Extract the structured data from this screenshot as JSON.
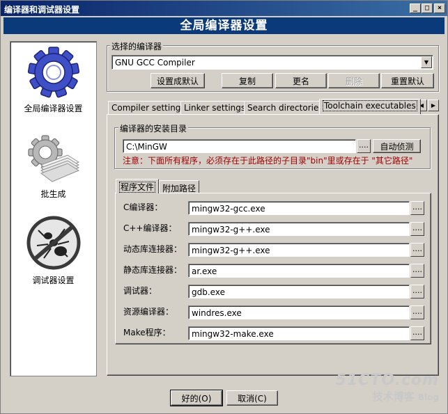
{
  "window": {
    "title": "编译器和调试器设置",
    "controls": [
      "_",
      "□",
      "×"
    ]
  },
  "banner": {
    "title": "全局编译器设置"
  },
  "sidebar": {
    "items": [
      {
        "label": "全局编译器设置",
        "icon": "gear-icon"
      },
      {
        "label": "批生成",
        "icon": "batch-build-icon"
      },
      {
        "label": "调试器设置",
        "icon": "debugger-ant-icon"
      }
    ]
  },
  "compiler_select": {
    "group_label": "选择的编译器",
    "value": "GNU GCC Compiler",
    "buttons": {
      "set_default": "设置成默认",
      "copy": "复制",
      "rename": "更名",
      "delete": "删除",
      "reset_default": "重置默认"
    }
  },
  "tabs": [
    {
      "label": "Compiler settings"
    },
    {
      "label": "Linker settings"
    },
    {
      "label": "Search directories"
    },
    {
      "label": "Toolchain executables"
    }
  ],
  "install_dir": {
    "group_label": "编译器的安装目录",
    "value": "C:\\MinGW",
    "browse": "....",
    "auto_detect": "自动侦测",
    "note": "注意：下面所有程序，必须存在于此路径的子目录\"bin\"里或存在于 \"其它路径\""
  },
  "subtabs": [
    {
      "label": "程序文件"
    },
    {
      "label": "附加路径"
    }
  ],
  "programs": [
    {
      "label": "C编译器：",
      "value": "mingw32-gcc.exe"
    },
    {
      "label": "C++编译器：",
      "value": "mingw32-g++.exe"
    },
    {
      "label": "动态库连接器：",
      "value": "mingw32-g++.exe"
    },
    {
      "label": "静态库连接器：",
      "value": "ar.exe"
    },
    {
      "label": "调试器：",
      "value": "gdb.exe"
    },
    {
      "label": "资源编译器：",
      "value": "windres.exe"
    },
    {
      "label": "Make程序：",
      "value": "mingw32-make.exe"
    }
  ],
  "browse_label": "....",
  "footer": {
    "ok": "好的(O)",
    "cancel": "取消(C)"
  },
  "watermark": {
    "site": "51CTO.com",
    "sub": "技术博客",
    "blog": "Blog"
  }
}
